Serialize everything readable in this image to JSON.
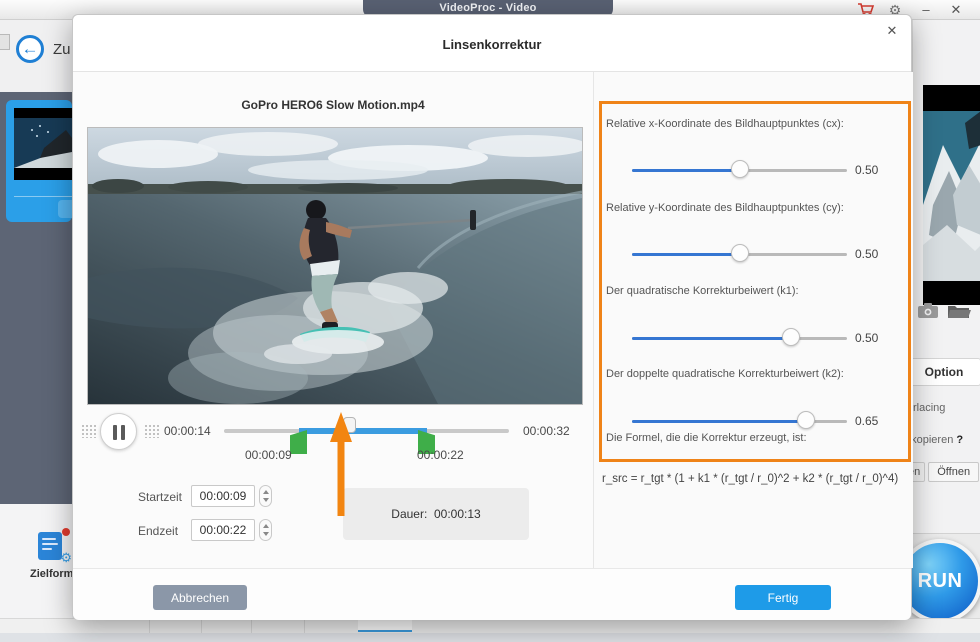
{
  "titlebar": {
    "app_title": "VideoProc - Video",
    "minimize_glyph": "–",
    "close_glyph": "✕",
    "gear_glyph": "⚙"
  },
  "background": {
    "back_label": "Zu",
    "zielformat_label": "Zielform",
    "option_button": "Option",
    "interlacing_partial": "rlacing",
    "kopieren_partial": ". kopieren",
    "help_mark": "?",
    "open_partial": "en",
    "open_button": "Öffnen",
    "run_button": "RUN"
  },
  "dialog": {
    "title": "Linsenkorrektur",
    "close_glyph": "✕",
    "video": {
      "filename": "GoPro HERO6 Slow Motion.mp4"
    },
    "player": {
      "current_time": "00:00:14",
      "total_time": "00:00:32",
      "trim_start": "00:00:09",
      "trim_end": "00:00:22"
    },
    "trim": {
      "start_label": "Startzeit",
      "start_value": "00:00:09",
      "end_label": "Endzeit",
      "end_value": "00:00:22",
      "duration_label": "Dauer:",
      "duration_value": "00:00:13"
    },
    "lens": {
      "sliders": [
        {
          "label": "Relative x-Koordinate des Bildhauptpunktes (cx):",
          "value": "0.50",
          "percent": 50
        },
        {
          "label": "Relative y-Koordinate des Bildhauptpunktes (cy):",
          "value": "0.50",
          "percent": 50
        },
        {
          "label": "Der quadratische Korrekturbeiwert (k1):",
          "value": "0.50",
          "percent": 74
        },
        {
          "label": "Der doppelte quadratische Korrekturbeiwert (k2):",
          "value": "0.65",
          "percent": 81
        }
      ],
      "formula_label": "Die Formel, die die Korrektur erzeugt, ist:",
      "formula": "r_src = r_tgt * (1 + k1 * (r_tgt / r_0)^2 + k2 * (r_tgt / r_0)^4)"
    },
    "footer": {
      "cancel": "Abbrechen",
      "done": "Fertig"
    }
  },
  "colors": {
    "accent_blue": "#1e9be8",
    "slider_blue": "#3576d2",
    "trim_green": "#3fae49",
    "annotation_orange": "#ef8318",
    "cart_red": "#d43b30"
  }
}
